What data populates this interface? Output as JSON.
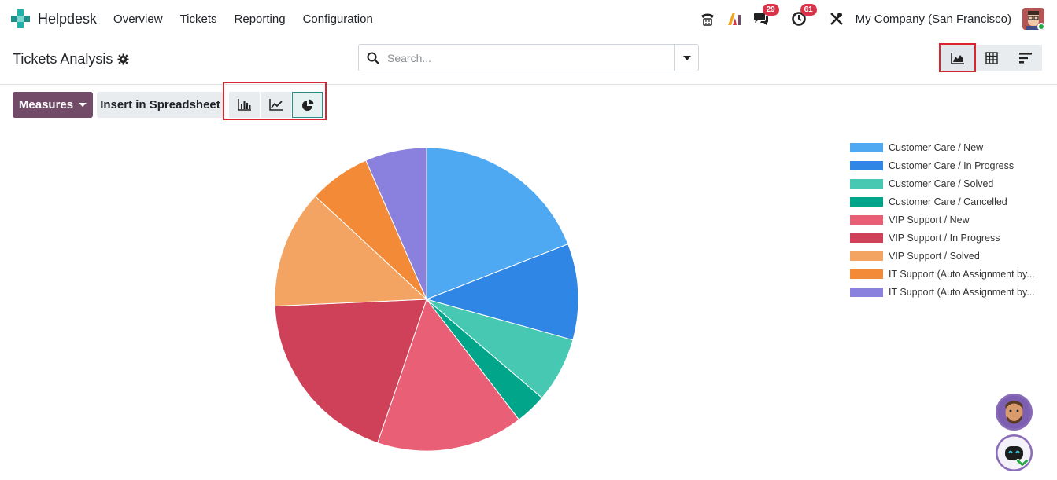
{
  "app": {
    "name": "Helpdesk",
    "brand_color": "#17a2a2"
  },
  "menu": [
    "Overview",
    "Tickets",
    "Reporting",
    "Configuration"
  ],
  "topbar": {
    "icons": [
      "phone-icon",
      "ai-icon",
      "chat-icon",
      "activity-clock-icon",
      "tools-icon"
    ],
    "chat_count": "29",
    "activity_count": "61",
    "company": "My Company (San Francisco)"
  },
  "page": {
    "title": "Tickets Analysis",
    "search_placeholder": "Search..."
  },
  "toolbar": {
    "measures_label": "Measures",
    "insert_label": "Insert in Spreadsheet",
    "active_chart_type": "pie",
    "active_view": "graph"
  },
  "chart_data": {
    "type": "pie",
    "legend_position": "right",
    "slices": [
      {
        "label": "Customer Care / New",
        "value": 19.5,
        "color": "#4fa8f2"
      },
      {
        "label": "Customer Care / In Progress",
        "value": 10.5,
        "color": "#2f86e4"
      },
      {
        "label": "Customer Care / Solved",
        "value": 7.1,
        "color": "#46c8b2"
      },
      {
        "label": "Customer Care / Cancelled",
        "value": 3.4,
        "color": "#00a58a"
      },
      {
        "label": "VIP Support / New",
        "value": 16.0,
        "color": "#e95f76"
      },
      {
        "label": "VIP Support / In Progress",
        "value": 19.5,
        "color": "#cf4059"
      },
      {
        "label": "VIP Support / Solved",
        "value": 12.9,
        "color": "#f4a462"
      },
      {
        "label": "IT Support (Auto Assignment by...",
        "value": 6.7,
        "color": "#f28a37"
      },
      {
        "label": "IT Support (Auto Assignment by...",
        "value": 6.7,
        "color": "#8a80de"
      }
    ]
  }
}
